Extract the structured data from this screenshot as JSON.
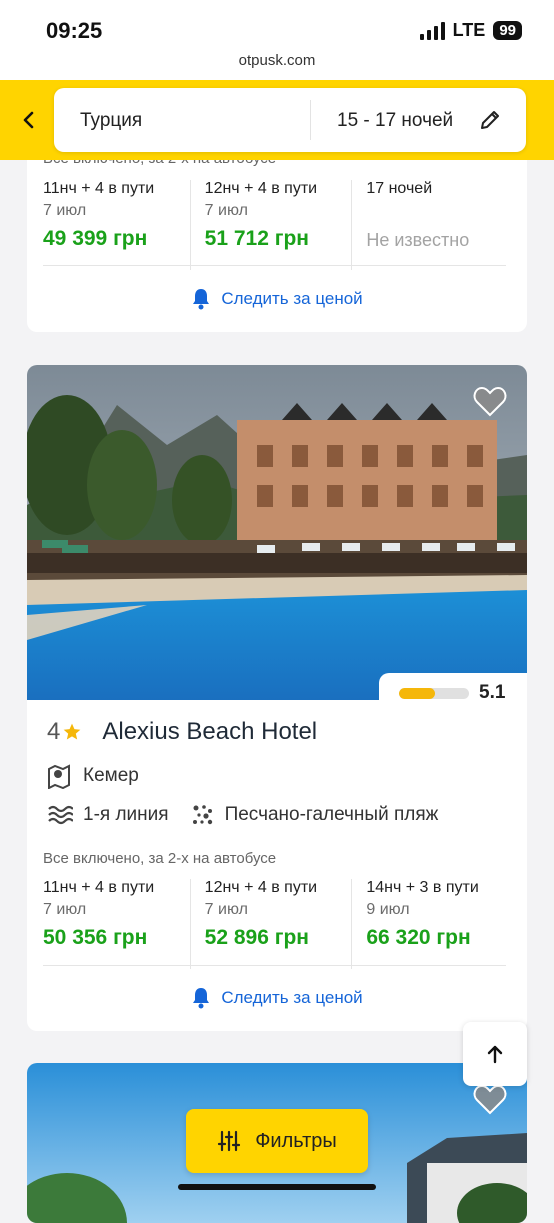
{
  "status_bar": {
    "time": "09:25",
    "network": "LTE",
    "battery": "99",
    "url": "otpusk.com"
  },
  "search": {
    "country": "Турция",
    "nights": "15 - 17 ночей"
  },
  "colors": {
    "brand_yellow": "#ffd400",
    "price_green": "#1aa11a",
    "link_blue": "#1565d8",
    "rating_fill": "#f5b70a"
  },
  "card1": {
    "meal_partial": "Все включено, за 2-х на автобусе",
    "offers": [
      {
        "duration": "11нч + 4 в пути",
        "date": "7 июл",
        "price": "49 399 грн"
      },
      {
        "duration": "12нч + 4 в пути",
        "date": "7 июл",
        "price": "51 712 грн"
      },
      {
        "duration": "17 ночей",
        "date": "",
        "price": "Не известно"
      }
    ],
    "follow_label": "Следить за ценой"
  },
  "card2": {
    "rating": "5.1",
    "rating_fraction": 0.51,
    "stars": "4",
    "name": "Alexius Beach Hotel",
    "location": "Кемер",
    "line": "1-я линия",
    "beach": "Песчано-галечный пляж",
    "meal": "Все включено, за 2-х на автобусе",
    "offers": [
      {
        "duration": "11нч + 4 в пути",
        "date": "7 июл",
        "price": "50 356 грн"
      },
      {
        "duration": "12нч + 4 в пути",
        "date": "7 июл",
        "price": "52 896 грн"
      },
      {
        "duration": "14нч + 3 в пути",
        "date": "9 июл",
        "price": "66 320 грн"
      }
    ],
    "follow_label": "Следить за ценой"
  },
  "filters_label": "Фильтры",
  "icons": {
    "back": "chevron-left-icon",
    "edit": "pencil-icon",
    "bell": "bell-icon",
    "heart": "heart-icon",
    "star": "star-icon",
    "map": "map-icon",
    "waves": "waves-icon",
    "pebbles": "pebbles-icon",
    "arrow_up": "arrow-up-icon",
    "sliders": "sliders-icon"
  }
}
